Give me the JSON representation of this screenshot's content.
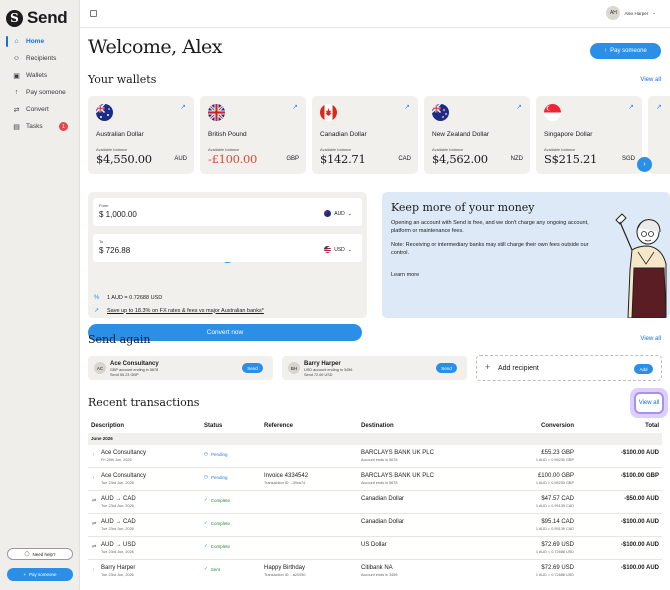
{
  "app": {
    "name": "Send"
  },
  "sidebar": {
    "items": [
      {
        "label": "Home",
        "icon": "home-icon",
        "glyph": "⌂",
        "active": true
      },
      {
        "label": "Recipients",
        "icon": "users-icon",
        "glyph": "👥"
      },
      {
        "label": "Wallets",
        "icon": "wallet-icon",
        "glyph": "▣"
      },
      {
        "label": "Pay someone",
        "icon": "arrow-up-icon",
        "glyph": "↑"
      },
      {
        "label": "Convert",
        "icon": "convert-icon",
        "glyph": "⇄"
      },
      {
        "label": "Tasks",
        "icon": "clipboard-icon",
        "glyph": "▤",
        "badge": "1"
      }
    ],
    "help_label": "Need help?",
    "pay_label": "Pay someone"
  },
  "header": {
    "user_initials": "AH",
    "user_name": "Alex Harper"
  },
  "main": {
    "welcome": "Welcome, Alex",
    "pay_button": "Pay someone",
    "wallets_title": "Your wallets",
    "view_all": "View all"
  },
  "wallets": [
    {
      "name": "Australian Dollar",
      "label": "Available balance",
      "balance": "$4,550.00",
      "currency": "AUD"
    },
    {
      "name": "British Pound",
      "label": "Available balance",
      "balance": "-£100.00",
      "currency": "GBP",
      "negative": true
    },
    {
      "name": "Canadian Dollar",
      "label": "Available balance",
      "balance": "$142.71",
      "currency": "CAD"
    },
    {
      "name": "New Zealand Dollar",
      "label": "Available balance",
      "balance": "$4,562.00",
      "currency": "NZD"
    },
    {
      "name": "Singapore Dollar",
      "label": "Available balance",
      "balance": "S$215.21",
      "currency": "SGD"
    }
  ],
  "converter": {
    "from_label": "From",
    "from_value": "1,000.00",
    "from_currency": "AUD",
    "to_label": "To",
    "to_value": "726.88",
    "to_currency": "USD",
    "rate": "1 AUD = 0.72688 USD",
    "save_text": "Save up to 18.3% on FX rates & fees vs major Australian banks*",
    "convert_button": "Convert now"
  },
  "promo": {
    "title": "Keep more of your money",
    "p1": "Opening an account with Send is free, and we don't charge any ongoing account, platform or maintenance fees.",
    "p2": "Note: Receiving or intermediary banks may still charge their own fees outside our control.",
    "learn_more": "Learn more"
  },
  "send_again": {
    "title": "Send again",
    "view_all": "View all",
    "contacts": [
      {
        "initials": "AC",
        "name": "Ace Consultancy",
        "sub1": "GBP account ending in 5678",
        "sub2": "Send 55.23 GBP",
        "button": "Send"
      },
      {
        "initials": "BH",
        "name": "Barry Harper",
        "sub1": "USD account ending in 3456",
        "sub2": "Send 72.69 USD",
        "button": "Send"
      }
    ],
    "add_label": "Add recipient",
    "add_button": "Add"
  },
  "transactions": {
    "title": "Recent transactions",
    "view_all": "View all",
    "headers": {
      "description": "Description",
      "status": "Status",
      "reference": "Reference",
      "destination": "Destination",
      "conversion": "Conversion",
      "total": "Total"
    },
    "group": "June 2026",
    "rows": [
      {
        "icon": "↑",
        "desc": "Ace Consultancy",
        "date": "Fri 26th Jun, 2026",
        "status": "Pending",
        "status_type": "pending",
        "ref": "",
        "ref_sub": "",
        "dest": "BARCLAYS BANK UK PLC",
        "dest_sub": "Account ends in 5678",
        "conv": "£55.23 GBP",
        "conv_sub": "1 AUD = 0.55230 GBP",
        "total": "-$100.00 AUD"
      },
      {
        "icon": "↑",
        "desc": "Ace Consultancy",
        "date": "Tue 23rd Jun, 2026",
        "status": "Pending",
        "status_type": "pending",
        "ref": "Invoice 4334542",
        "ref_sub": "Transaction ID ...39ca74",
        "dest": "BARCLAYS BANK UK PLC",
        "dest_sub": "Account ends in 5678",
        "conv": "£100.00 GBP",
        "conv_sub": "1 AUD = 0.55230 GBP",
        "total": "-$100.00 GBP"
      },
      {
        "icon": "⇄",
        "desc": "AUD → CAD",
        "date": "Tue 23rd Jun, 2026",
        "status": "Complete",
        "status_type": "complete",
        "ref": "",
        "ref_sub": "",
        "dest": "Canadian Dollar",
        "dest_sub": "",
        "conv": "$47.57 CAD",
        "conv_sub": "1 AUD = 0.95139 CAD",
        "total": "-$50.00 AUD"
      },
      {
        "icon": "⇄",
        "desc": "AUD → CAD",
        "date": "Tue 23rd Jun, 2026",
        "status": "Complete",
        "status_type": "complete",
        "ref": "",
        "ref_sub": "",
        "dest": "Canadian Dollar",
        "dest_sub": "",
        "conv": "$95.14 CAD",
        "conv_sub": "1 AUD = 0.95139 CAD",
        "total": "-$100.00 AUD"
      },
      {
        "icon": "⇄",
        "desc": "AUD → USD",
        "date": "Tue 23rd Jun, 2026",
        "status": "Complete",
        "status_type": "complete",
        "ref": "",
        "ref_sub": "",
        "dest": "US Dollar",
        "dest_sub": "",
        "conv": "$72.69 USD",
        "conv_sub": "1 AUD = 0.72688 USD",
        "total": "-$100.00 AUD"
      },
      {
        "icon": "↑",
        "desc": "Barry Harper",
        "date": "Tue 23rd Jun, 2026",
        "status": "Sent",
        "status_type": "complete",
        "ref": "Happy Birthday",
        "ref_sub": "Transaction ID ...a20050",
        "dest": "Citibank NA",
        "dest_sub": "Account ends in 3456",
        "conv": "$72.69 USD",
        "conv_sub": "1 AUD = 0.72688 USD",
        "total": "-$100.00 AUD"
      }
    ]
  },
  "colors": {
    "accent": "#2b8fe8",
    "negative": "#d94c3a",
    "sidebar": "#efeeea",
    "card": "#f1f0ec",
    "promo": "#dde9f7",
    "highlight": "#a98ff0"
  }
}
